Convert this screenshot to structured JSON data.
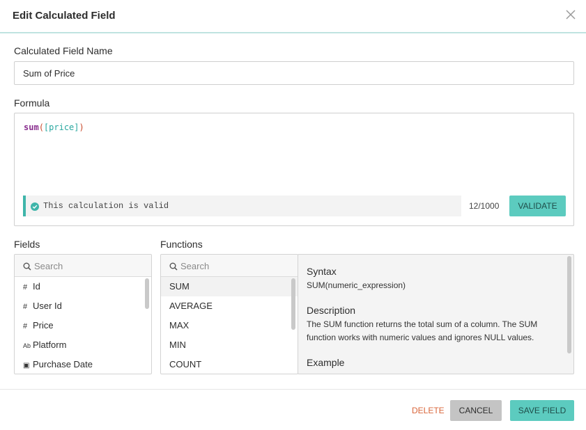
{
  "dialog": {
    "title": "Edit Calculated Field"
  },
  "name_field": {
    "label": "Calculated Field Name",
    "value": "Sum of Price"
  },
  "formula": {
    "label": "Formula",
    "fn": "sum",
    "open_paren": "(",
    "field": "[price]",
    "close_paren": ")",
    "status_text": "This calculation is valid",
    "counter": "12/1000",
    "validate_label": "VALIDATE"
  },
  "fields": {
    "label": "Fields",
    "search_placeholder": "Search",
    "items": [
      {
        "icon": "#",
        "icon_name": "number-type-icon",
        "label": "Id"
      },
      {
        "icon": "#",
        "icon_name": "number-type-icon",
        "label": "User Id"
      },
      {
        "icon": "#",
        "icon_name": "number-type-icon",
        "label": "Price"
      },
      {
        "icon": "Ab",
        "icon_name": "text-type-icon",
        "label": "Platform"
      },
      {
        "icon": "▣",
        "icon_name": "date-type-icon",
        "label": "Purchase Date"
      }
    ]
  },
  "functions": {
    "label": "Functions",
    "search_placeholder": "Search",
    "items": [
      "SUM",
      "AVERAGE",
      "MAX",
      "MIN",
      "COUNT"
    ]
  },
  "description": {
    "syntax_heading": "Syntax",
    "syntax_text": "SUM(numeric_expression)",
    "description_heading": "Description",
    "description_text": "The SUM function returns the total sum of a column. The SUM function works with numeric values and ignores NULL values.",
    "example_heading": "Example"
  },
  "footer": {
    "delete_label": "DELETE",
    "cancel_label": "CANCEL",
    "save_label": "SAVE FIELD"
  },
  "colors": {
    "accent": "#5ccbbf",
    "delete": "#d9653a",
    "valid": "#3fb5aa"
  }
}
